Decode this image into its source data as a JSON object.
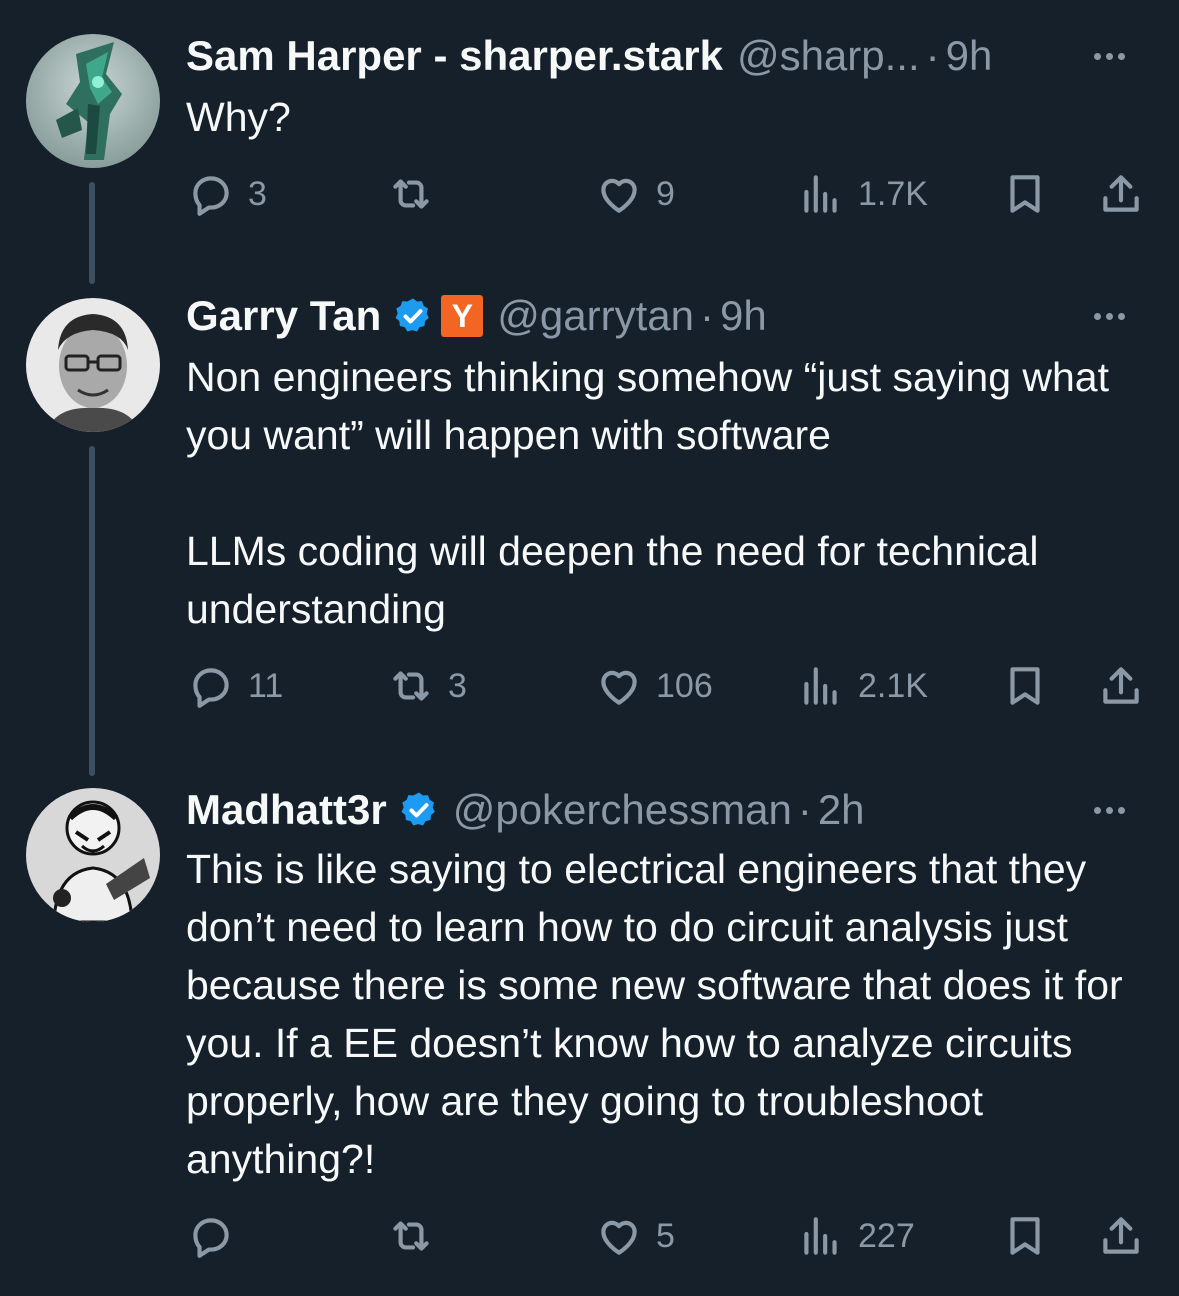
{
  "tweets": [
    {
      "name": "Sam Harper - sharper.stark",
      "handle": "@sharp...",
      "time": "9h",
      "body": "Why?",
      "replies": "3",
      "reposts": "",
      "likes": "9",
      "views": "1.7K"
    },
    {
      "name": "Garry Tan",
      "verified": true,
      "affiliate_badge": "Y",
      "handle": "@garrytan",
      "time": "9h",
      "body": "Non engineers thinking somehow “just saying what you want” will happen with software\n\nLLMs coding will deepen the need for technical understanding",
      "replies": "11",
      "reposts": "3",
      "likes": "106",
      "views": "2.1K"
    },
    {
      "name": "Madhatt3r",
      "verified": true,
      "handle": "@pokerchessman",
      "time": "2h",
      "body": "This is like saying to electrical engineers that they don’t need to learn how to do circuit analysis just because there is some new software that does it for you. If a EE doesn’t know how to analyze circuits properly, how are they going to troubleshoot anything?!",
      "replies": "",
      "reposts": "",
      "likes": "5",
      "views": "227"
    }
  ],
  "dot_separator": "·",
  "colors": {
    "background": "#15202b",
    "text": "#f7f9f9",
    "muted": "#8b98a5",
    "verified": "#1d9bf0",
    "yc_orange": "#f26522",
    "thread_line": "#3d4f60"
  },
  "icons": [
    "reply-icon",
    "repost-icon",
    "like-icon",
    "views-icon",
    "bookmark-icon",
    "share-icon",
    "more-icon",
    "verified-icon"
  ]
}
